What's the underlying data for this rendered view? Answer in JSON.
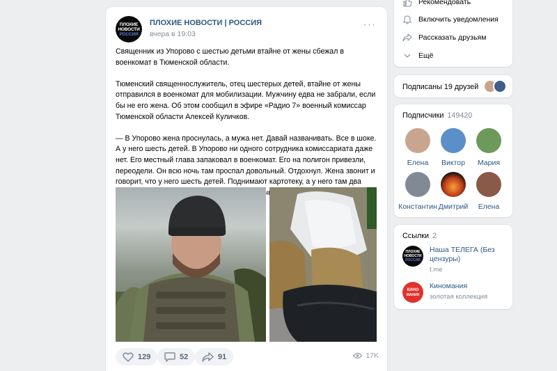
{
  "post": {
    "avatar_text": [
      "ПЛОХИЕ",
      "НОВОСТИ",
      "РОССИЯ"
    ],
    "author": "ПЛОХИЕ НОВОСТИ | РОССИЯ",
    "time": "вчера в 19:03",
    "paragraphs": [
      "Священник из Упорово с шестью детьми втайне от жены сбежал в военкомат в Тюменской области.",
      "Тюменский священнослужитель, отец шестерых детей, втайне от жены отправился в военкомат для мобилизации. Мужчину едва не забрали, если бы не его жена. Об этом сообщил в эфире «Радио 7» военный комиссар Тюменской области Алексей Куличков.",
      "— В Упорово жена проснулась, а мужа нет. Давай названивать. Все в шоке. А у него шесть детей. В Упорово ни одного сотрудника комиссариата даже нет. Его местный глава запаковал в военкомат. Его на полигон привезли, переодели. Он всю ночь там проспал довольный. Отдохнул. Жена звонит и говорит, что у него шесть детей. Поднимают картотеку, а у него там два ребенка. Он ничего никому не сказал. Конечно, форму забрали, а его вернули домой, — рассказал Куличков."
    ],
    "likes": "129",
    "comments": "52",
    "shares": "91",
    "views": "17K"
  },
  "sidebar": {
    "menu": [
      {
        "label": "Рекомендовать",
        "icon": "thumb-icon"
      },
      {
        "label": "Включить уведомления",
        "icon": "bell-icon"
      },
      {
        "label": "Рассказать друзьям",
        "icon": "share-icon"
      },
      {
        "label": "Ещё",
        "icon": "chevron-down-icon"
      }
    ],
    "friends_text": "Подписаны 19 друзей",
    "subscribers": {
      "title": "Подписчики",
      "count": "149420",
      "people": [
        {
          "name": "Елена",
          "color": "#c9a590"
        },
        {
          "name": "Виктор",
          "color": "#5b8fc9"
        },
        {
          "name": "Мария",
          "color": "#6d9a5a"
        },
        {
          "name": "Константин",
          "color": "#7f8a95"
        },
        {
          "name": "Дмитрий",
          "color": "#e0732a"
        },
        {
          "name": "Елена",
          "color": "#8a5a48"
        }
      ]
    },
    "links": {
      "title": "Ссылки",
      "count": "2",
      "items": [
        {
          "title": "Наша ТЕЛЕГА (Без цензуры)",
          "sub": "t.me",
          "avatar_text": [
            "ПЛОХИЕ",
            "НОВОСТИ",
            "РОССИЯ"
          ],
          "avatar_color": "#0a0a0a"
        },
        {
          "title": "Киномания",
          "sub": "золотая коллекция",
          "avatar_text": [
            "КИНО",
            "МАНИЯ"
          ],
          "avatar_color": "#e2312b"
        }
      ]
    }
  },
  "colors": {
    "link": "#2a5885",
    "muted": "#818c99",
    "background": "#edeef0"
  }
}
